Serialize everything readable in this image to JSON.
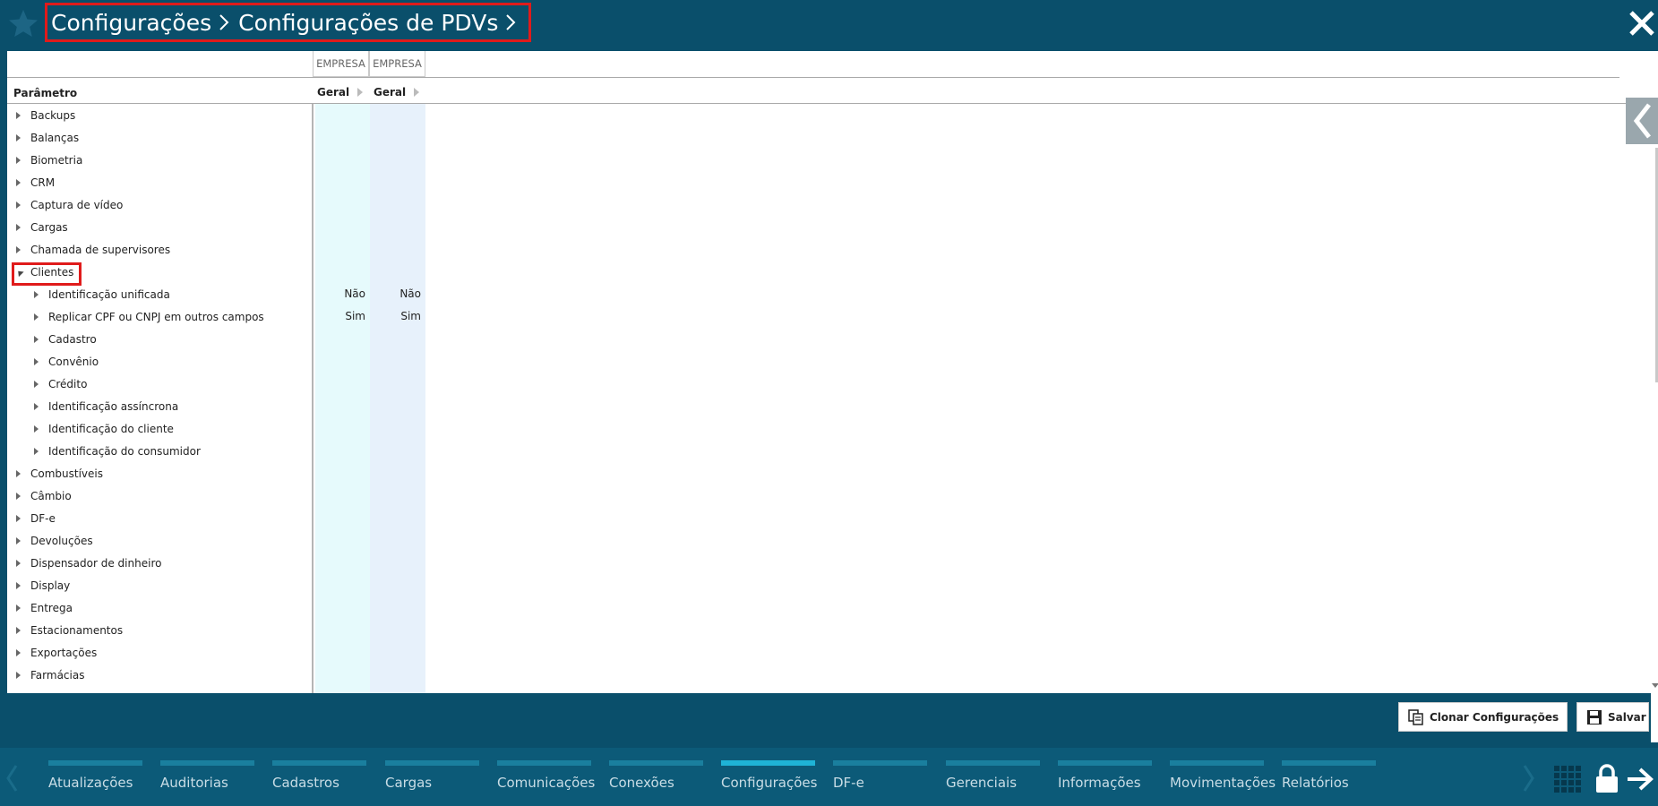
{
  "header": {
    "breadcrumb": [
      "Configurações",
      "Configurações de PDVs"
    ]
  },
  "grid": {
    "column_groups": [
      "EMPRESA",
      "EMPRESA"
    ],
    "param_header": "Parâmetro",
    "column_headers": [
      "Geral",
      "Geral"
    ],
    "rows": [
      {
        "label": "Backups",
        "level": 0,
        "expanded": false,
        "v1": "",
        "v2": ""
      },
      {
        "label": "Balanças",
        "level": 0,
        "expanded": false,
        "v1": "",
        "v2": ""
      },
      {
        "label": "Biometria",
        "level": 0,
        "expanded": false,
        "v1": "",
        "v2": ""
      },
      {
        "label": "CRM",
        "level": 0,
        "expanded": false,
        "v1": "",
        "v2": ""
      },
      {
        "label": "Captura de vídeo",
        "level": 0,
        "expanded": false,
        "v1": "",
        "v2": ""
      },
      {
        "label": "Cargas",
        "level": 0,
        "expanded": false,
        "v1": "",
        "v2": ""
      },
      {
        "label": "Chamada de supervisores",
        "level": 0,
        "expanded": false,
        "v1": "",
        "v2": ""
      },
      {
        "label": "Clientes",
        "level": 0,
        "expanded": true,
        "v1": "",
        "v2": ""
      },
      {
        "label": "Identificação unificada",
        "level": 1,
        "expanded": false,
        "v1": "Não",
        "v2": "Não"
      },
      {
        "label": "Replicar CPF ou CNPJ em outros campos",
        "level": 1,
        "expanded": false,
        "v1": "Sim",
        "v2": "Sim"
      },
      {
        "label": "Cadastro",
        "level": 1,
        "expanded": false,
        "v1": "",
        "v2": ""
      },
      {
        "label": "Convênio",
        "level": 1,
        "expanded": false,
        "v1": "",
        "v2": ""
      },
      {
        "label": "Crédito",
        "level": 1,
        "expanded": false,
        "v1": "",
        "v2": ""
      },
      {
        "label": "Identificação assíncrona",
        "level": 1,
        "expanded": false,
        "v1": "",
        "v2": ""
      },
      {
        "label": "Identificação do cliente",
        "level": 1,
        "expanded": false,
        "v1": "",
        "v2": ""
      },
      {
        "label": "Identificação do consumidor",
        "level": 1,
        "expanded": false,
        "v1": "",
        "v2": ""
      },
      {
        "label": "Combustíveis",
        "level": 0,
        "expanded": false,
        "v1": "",
        "v2": ""
      },
      {
        "label": "Câmbio",
        "level": 0,
        "expanded": false,
        "v1": "",
        "v2": ""
      },
      {
        "label": "DF-e",
        "level": 0,
        "expanded": false,
        "v1": "",
        "v2": ""
      },
      {
        "label": "Devoluções",
        "level": 0,
        "expanded": false,
        "v1": "",
        "v2": ""
      },
      {
        "label": "Dispensador de dinheiro",
        "level": 0,
        "expanded": false,
        "v1": "",
        "v2": ""
      },
      {
        "label": "Display",
        "level": 0,
        "expanded": false,
        "v1": "",
        "v2": ""
      },
      {
        "label": "Entrega",
        "level": 0,
        "expanded": false,
        "v1": "",
        "v2": ""
      },
      {
        "label": "Estacionamentos",
        "level": 0,
        "expanded": false,
        "v1": "",
        "v2": ""
      },
      {
        "label": "Exportações",
        "level": 0,
        "expanded": false,
        "v1": "",
        "v2": ""
      },
      {
        "label": "Farmácias",
        "level": 0,
        "expanded": false,
        "v1": "",
        "v2": ""
      }
    ]
  },
  "actions": {
    "clone_label": "Clonar Configurações",
    "save_label": "Salvar"
  },
  "nav": {
    "items": [
      "Atualizações",
      "Auditorias",
      "Cadastros",
      "Cargas",
      "Comunicações",
      "Conexões",
      "Configurações",
      "DF-e",
      "Gerenciais",
      "Informações",
      "Movimentações",
      "Relatórios"
    ],
    "active": "Configurações"
  },
  "colors": {
    "header_bg": "#0a4f6b",
    "nav_bg": "#0c5a78",
    "nav_bar": "#1a7f9e",
    "nav_bar_active": "#1fb3d6",
    "highlight": "#e01b1b"
  }
}
